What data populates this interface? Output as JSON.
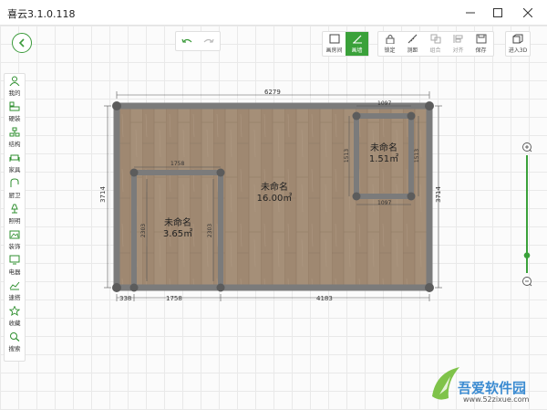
{
  "window": {
    "title": "喜云3.1.0.118"
  },
  "toolbar_view": {
    "room_label": "画房间",
    "wall_label": "画墙"
  },
  "toolbar_edit": {
    "lock_label": "锁定",
    "measure_label": "测距",
    "group_label": "组合",
    "align_label": "对齐",
    "save_label": "保存"
  },
  "toolbar_3d": {
    "enter3d_label": "进入3D"
  },
  "sidebar": {
    "items": [
      {
        "label": "我的",
        "icon": "user-icon"
      },
      {
        "label": "硬装",
        "icon": "hard-decoration-icon"
      },
      {
        "label": "结构",
        "icon": "structure-icon"
      },
      {
        "label": "家具",
        "icon": "sofa-icon"
      },
      {
        "label": "厨卫",
        "icon": "faucet-icon"
      },
      {
        "label": "照明",
        "icon": "lamp-icon"
      },
      {
        "label": "装饰",
        "icon": "picture-frame-icon"
      },
      {
        "label": "电器",
        "icon": "monitor-icon"
      },
      {
        "label": "速搭",
        "icon": "quick-build-icon"
      },
      {
        "label": "收藏",
        "icon": "star-icon"
      },
      {
        "label": "搜索",
        "icon": "search-icon"
      }
    ]
  },
  "zoom": {
    "level_fraction": 0.15
  },
  "plan": {
    "dims": {
      "outer_top": "6279",
      "outer_left": "3714",
      "outer_right": "3714",
      "bottom_a": "338",
      "bottom_b": "1758",
      "bottom_c": "4183",
      "room1_top": "1758",
      "room1_left": "2303",
      "room1_right": "2303",
      "room2_top": "1097",
      "room2_bottom": "1097",
      "room2_left": "1513",
      "room2_right": "1513"
    },
    "rooms": [
      {
        "name": "未命名",
        "area": "16.00㎡"
      },
      {
        "name": "未命名",
        "area": "3.65㎡"
      },
      {
        "name": "未命名",
        "area": "1.51㎡"
      }
    ]
  },
  "watermark": {
    "brand": "吾爱软件园",
    "url": "www.52zixue.com"
  },
  "colors": {
    "accent": "#3aa13a",
    "wall": "#7b7b7b",
    "node": "#5c5c5c",
    "floor": "#a38e78"
  }
}
